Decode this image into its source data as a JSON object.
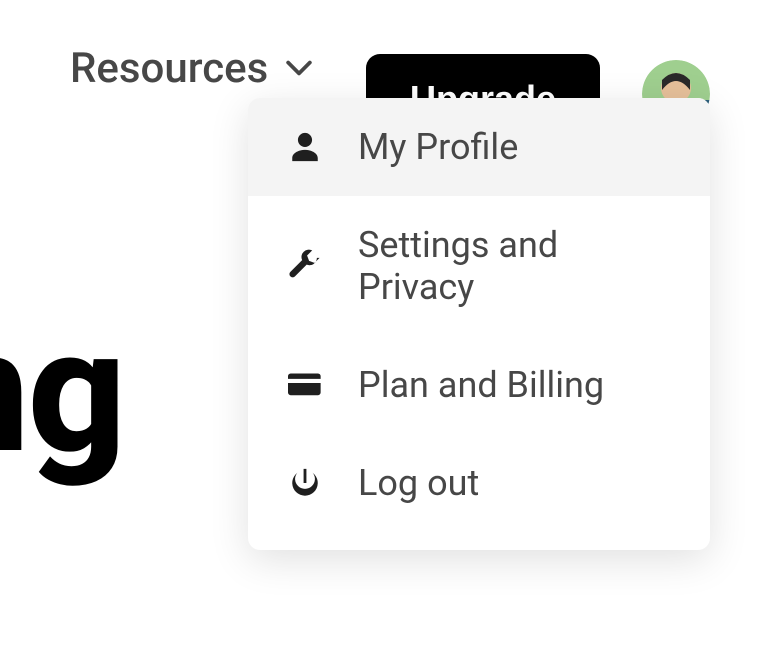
{
  "header": {
    "nav": {
      "resources_label": "Resources"
    },
    "upgrade_label": "Upgrade"
  },
  "user_menu": {
    "items": [
      {
        "label": "My Profile",
        "icon": "user-icon",
        "active": true
      },
      {
        "label": "Settings and Privacy",
        "icon": "wrench-icon",
        "active": false
      },
      {
        "label": "Plan and Billing",
        "icon": "card-icon",
        "active": false
      },
      {
        "label": "Log out",
        "icon": "power-icon",
        "active": false
      }
    ]
  },
  "background": {
    "word": "owing"
  }
}
